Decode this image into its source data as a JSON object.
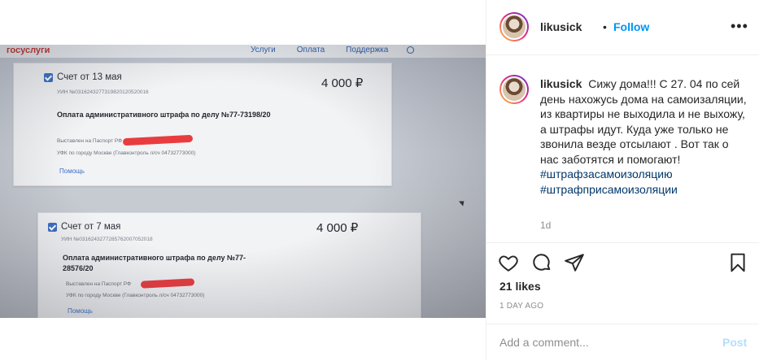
{
  "post": {
    "photo": {
      "site": {
        "logo": "госуслуги",
        "nav": [
          "Услуги",
          "Оплата",
          "Поддержка"
        ]
      },
      "bills": [
        {
          "title": "Счет от 13 мая",
          "amount": "4 000 ₽",
          "uin": "УИН №0316243277319820120520016",
          "purpose": "Оплата административного штрафа по делу №77-73198/20",
          "issued": "Выставлен на Паспорт РФ",
          "ufk": "УФК по городу Москве (Главконтроль л/сч 04732773000)",
          "help": "Помощь"
        },
        {
          "title": "Счет от 7 мая",
          "amount": "4 000 ₽",
          "uin": "УИН №0316243277285762007052018",
          "purpose": "Оплата административного штрафа по делу №77-28576/20",
          "issued": "Выставлен на Паспорт РФ",
          "ufk": "УФК по городу Москве (Главконтроль л/сч 04732773000)",
          "help": "Помощь"
        }
      ]
    },
    "header": {
      "username": "likusick",
      "separator": "•",
      "follow_label": "Follow",
      "more_label": "•••"
    },
    "caption": {
      "username": "likusick",
      "text": "Сижу дома!!! С 27. 04 по сей день нахожусь дома на самоизаляции, из квартиры не выходила и не выхожу, а штрафы идут. Куда уже только не звонила везде отсылают . Вот так о нас заботятся и помогают!",
      "hashtags": [
        "#штрафзасамоизоляцию",
        "#штрафприсамоизоляции"
      ],
      "time": "1d"
    },
    "actions": {
      "like_icon": "heart-icon",
      "comment_icon": "comment-icon",
      "share_icon": "paper-plane-icon",
      "save_icon": "bookmark-icon"
    },
    "likes": "21 likes",
    "date": "1 DAY AGO",
    "comment": {
      "placeholder": "Add a comment...",
      "post_label": "Post"
    },
    "colors": {
      "link": "#0095f6",
      "hashtag": "#00376b",
      "muted": "#8e8e8e",
      "post_disabled": "#b2dffc"
    }
  }
}
